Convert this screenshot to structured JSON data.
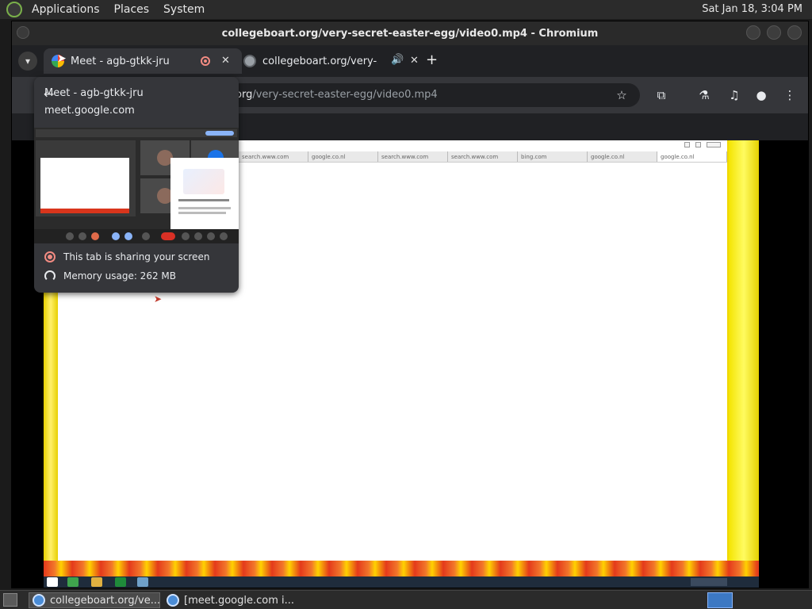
{
  "top_panel": {
    "menus": [
      "Applications",
      "Places",
      "System"
    ],
    "clock": "Sat Jan 18,  3:04 PM"
  },
  "window": {
    "title": "collegeboart.org/very-secret-easter-egg/video0.mp4 - Chromium"
  },
  "tabs": [
    {
      "title": "Meet - agb-gtkk-jru",
      "active": true,
      "recording": true,
      "close": "✕"
    },
    {
      "title": "collegeboart.org/very-sec",
      "active": false,
      "audio": true,
      "close": "✕"
    }
  ],
  "new_tab_label": "+",
  "omnibox": {
    "host": "org",
    "path": "/very-secret-easter-egg/video0.mp4"
  },
  "hover_card": {
    "title": "Meet - agb-gtkk-jru",
    "url": "meet.google.com",
    "sharing_text": "This tab is sharing your screen",
    "memory_text": "Memory usage: 262 MB"
  },
  "video": {
    "tabs": [
      "search.www.com",
      "google.co.nl",
      "search.www.com",
      "search.www.com",
      "bing.com",
      "google.co.nl",
      "google.co.nl"
    ]
  },
  "taskbar": {
    "items": [
      {
        "label": "collegeboart.org/ve...",
        "active": true
      },
      {
        "label": "[meet.google.com i...",
        "active": false
      }
    ]
  },
  "colors": {
    "accent_red": "#f28b82",
    "chrome_dark": "#202124",
    "video_yellow": "#f0d800"
  }
}
